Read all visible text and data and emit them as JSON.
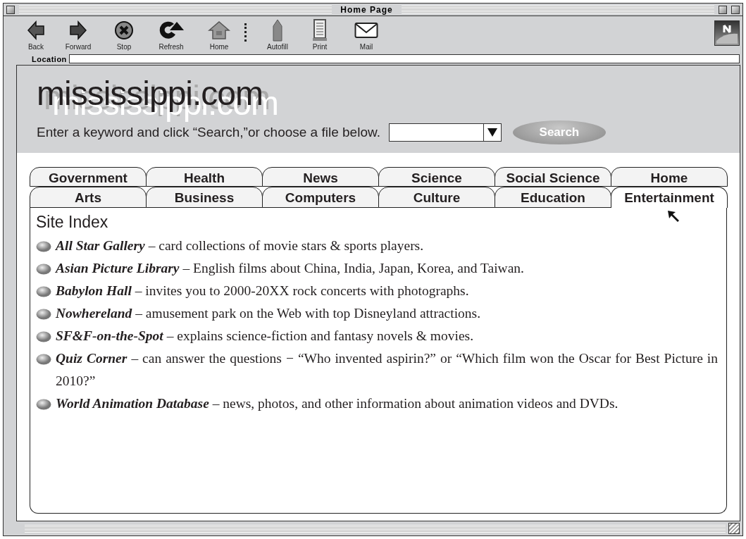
{
  "window": {
    "title": "Home Page"
  },
  "toolbar": [
    {
      "kind": "back",
      "label": "Back"
    },
    {
      "kind": "forward",
      "label": "Forward"
    },
    {
      "kind": "stop",
      "label": "Stop"
    },
    {
      "kind": "refresh",
      "label": "Refresh"
    },
    {
      "kind": "home",
      "label": "Home"
    },
    {
      "kind": "separator"
    },
    {
      "kind": "autofill",
      "label": "Autofill"
    },
    {
      "kind": "print",
      "label": "Print"
    },
    {
      "kind": "mail",
      "label": "Mail"
    }
  ],
  "location": {
    "label": "Location"
  },
  "header": {
    "logo": "mississippi.com",
    "prompt": "Enter a keyword and click “Search,”or choose a file below.",
    "search_button": "Search"
  },
  "tabs": [
    [
      {
        "label": "Government",
        "selected": false
      },
      {
        "label": "Health",
        "selected": false
      },
      {
        "label": "News",
        "selected": false
      },
      {
        "label": "Science",
        "selected": false
      },
      {
        "label": "Social Science",
        "selected": false
      },
      {
        "label": "Home",
        "selected": false
      }
    ],
    [
      {
        "label": "Arts",
        "selected": false
      },
      {
        "label": "Business",
        "selected": false
      },
      {
        "label": "Computers",
        "selected": false
      },
      {
        "label": "Culture",
        "selected": false
      },
      {
        "label": "Education",
        "selected": false
      },
      {
        "label": "Entertainment",
        "selected": true
      }
    ]
  ],
  "site_index": {
    "title": "Site Index",
    "items": [
      {
        "name": "All Star Gallery",
        "description": "– card collections of movie stars & sports players."
      },
      {
        "name": "Asian Picture Library",
        "description": "– English films about China, India, Japan, Korea, and Taiwan."
      },
      {
        "name": "Babylon Hall",
        "description": "– invites you to 2000-20XX rock concerts with photographs."
      },
      {
        "name": "Nowhereland",
        "description": "– amusement park on the Web with top Disneyland attractions."
      },
      {
        "name": "SF&F-on-the-Spot",
        "description": "– explains science-fiction and fantasy novels & movies."
      },
      {
        "name": "Quiz Corner",
        "description": "– can answer the questions  −  “Who invented aspirin?” or “Which film won the Oscar for Best Picture in 2010?”"
      },
      {
        "name": "World Animation Database",
        "description": "– news, photos, and other information about animation videos and DVDs."
      }
    ]
  }
}
